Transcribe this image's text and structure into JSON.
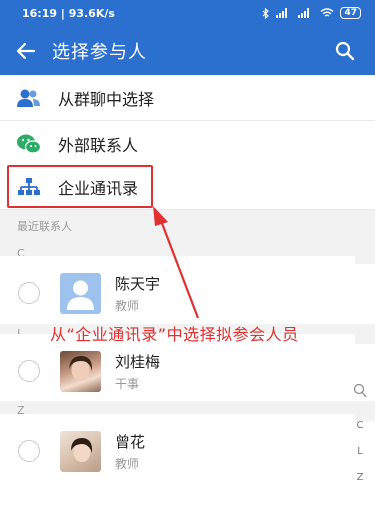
{
  "status_bar": {
    "time_speed": "16:19 | 93.6K/s",
    "battery": "47"
  },
  "header": {
    "title": "选择参与人"
  },
  "options": [
    {
      "label": "从群聊中选择",
      "icon": "group-icon"
    },
    {
      "label": "外部联系人",
      "icon": "wechat-icon"
    },
    {
      "label": "企业通讯录",
      "icon": "org-chart-icon"
    }
  ],
  "recent_header": "最近联系人",
  "sections": [
    {
      "letter": "C",
      "contact": {
        "name": "陈天宇",
        "role": "教师"
      }
    },
    {
      "letter": "L",
      "contact": {
        "name": "刘桂梅",
        "role": "干事"
      }
    },
    {
      "letter": "Z",
      "contact": {
        "name": "曾花",
        "role": "教师"
      }
    }
  ],
  "index_letters": [
    "C",
    "L",
    "Z"
  ],
  "annotation": "从“企业通讯录”中选择拟参会人员",
  "colors": {
    "app_bar": "#2b70cf",
    "annotation": "#e03030",
    "icon_blue": "#2b70cf",
    "wechat_green": "#2aae67"
  }
}
